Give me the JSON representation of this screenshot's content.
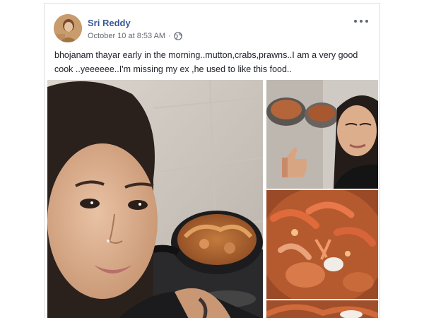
{
  "post": {
    "author": "Sri Reddy",
    "timestamp": "October 10 at 8:53 AM",
    "meta_separator": "·",
    "privacy_icon": "globe-icon",
    "more_icon": "more-options-icon",
    "text": "bhojanam thayar early in the morning..mutton,crabs,prawns..I am a very good cook ..yeeeeee..I'm missing my ex ,he used to like this food..",
    "photos": [
      {
        "subject": "selfie-cooking-pan"
      },
      {
        "subject": "selfie-thumbs-up-with-pans"
      },
      {
        "subject": "crab-prawn-curry"
      },
      {
        "subject": "crab-curry-partial"
      }
    ]
  },
  "colors": {
    "author_link": "#385898",
    "meta_text": "#616770",
    "body_text": "#1d2129",
    "border": "#dddfe2"
  }
}
